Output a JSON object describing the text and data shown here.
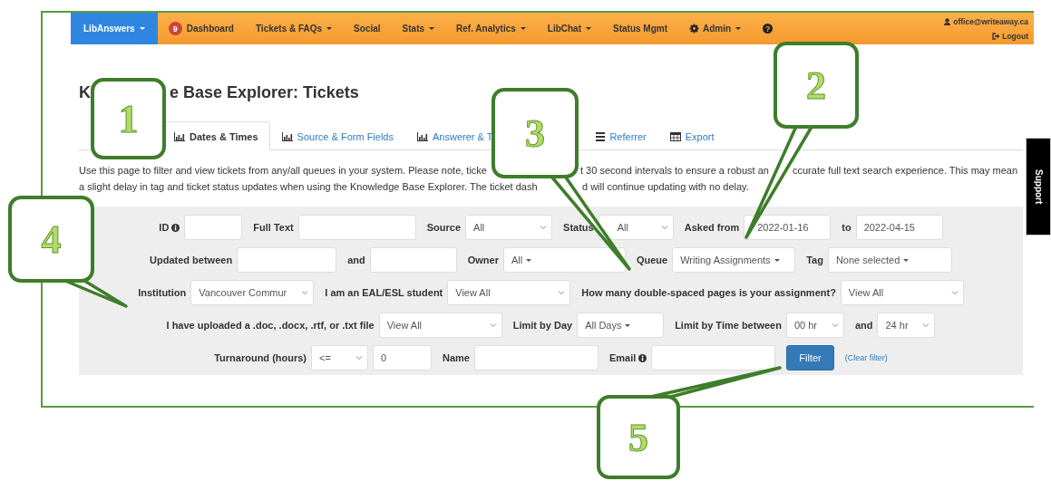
{
  "nav": {
    "items": [
      {
        "label": "LibAnswers",
        "dropdown": true,
        "selected": true
      },
      {
        "label": "Dashboard",
        "badge": "9",
        "dropdown": false,
        "selected": false
      },
      {
        "label": "Tickets & FAQs",
        "dropdown": true,
        "selected": false
      },
      {
        "label": "Social",
        "dropdown": false,
        "selected": false
      },
      {
        "label": "Stats",
        "dropdown": true,
        "selected": false
      },
      {
        "label": "Ref. Analytics",
        "dropdown": true,
        "selected": false
      },
      {
        "label": "LibChat",
        "dropdown": true,
        "selected": false
      },
      {
        "label": "Status Mgmt",
        "dropdown": false,
        "selected": false
      },
      {
        "label": "Admin",
        "dropdown": true,
        "selected": false
      }
    ],
    "help": "?",
    "user": "office@writeaway.ca",
    "logout": "Logout"
  },
  "title_fragments": [
    "K",
    "e Base Explorer: Tickets"
  ],
  "tabs": [
    {
      "label": "Dates & Times",
      "selected": true
    },
    {
      "label": "Source & Form Fields",
      "selected": false
    },
    {
      "label": "Answerer & T",
      "selected": false
    },
    {
      "label": "Referrer",
      "selected": false
    },
    {
      "label": "Export",
      "selected": false
    }
  ],
  "notice_lines": [
    [
      "Use this page to filter and view tickets from any/all queues in your system. Please note, ticke",
      "t 30 second intervals to ensure a robust an",
      "ccurate full text search experience. This may mean"
    ],
    [
      "a slight delay in tag and ticket status updates when using the Knowledge Base Explorer. The ticket dash",
      "d will continue updating with no delay."
    ]
  ],
  "filter_rows": [
    [
      {
        "label": "ID",
        "info": true,
        "controls": [
          {
            "kind": "input"
          }
        ]
      },
      {
        "label": "Full Text",
        "controls": [
          {
            "kind": "input"
          }
        ]
      },
      {
        "label": "Source",
        "controls": [
          {
            "kind": "select",
            "value": "All"
          }
        ]
      },
      {
        "label": "Status",
        "controls": [
          {
            "kind": "select",
            "value": "All"
          }
        ]
      },
      {
        "label": "Asked from",
        "controls": [
          {
            "kind": "input",
            "value": "2022-01-16"
          }
        ]
      },
      {
        "label": "to",
        "controls": [
          {
            "kind": "input",
            "value": "2022-04-15"
          }
        ]
      }
    ],
    [
      {
        "label": "Updated between",
        "controls": [
          {
            "kind": "input"
          }
        ]
      },
      {
        "label": "and",
        "controls": [
          {
            "kind": "input"
          }
        ]
      },
      {
        "label": "Owner",
        "controls": [
          {
            "kind": "dropdown",
            "value": "All"
          }
        ]
      },
      {
        "label": "Queue",
        "controls": [
          {
            "kind": "dropdown",
            "value": "Writing Assignments"
          }
        ]
      },
      {
        "label": "Tag",
        "controls": [
          {
            "kind": "dropdown",
            "value": "None selected"
          }
        ]
      }
    ],
    [
      {
        "label": "Institution",
        "controls": [
          {
            "kind": "select",
            "value": "Vancouver Commur"
          }
        ]
      },
      {
        "label": "I am an EAL/ESL student",
        "controls": [
          {
            "kind": "select",
            "value": "View All"
          }
        ]
      },
      {
        "label": "How many double-spaced pages is your assignment?",
        "controls": [
          {
            "kind": "select",
            "value": "View All"
          }
        ]
      }
    ],
    [
      {
        "label": "I have uploaded a .doc, .docx, .rtf, or .txt file",
        "controls": [
          {
            "kind": "select",
            "value": "View All"
          }
        ]
      },
      {
        "label": "Limit by Day",
        "controls": [
          {
            "kind": "dropdown",
            "value": "All Days"
          }
        ]
      },
      {
        "label": "Limit by Time between",
        "controls": [
          {
            "kind": "select",
            "value": "00 hr"
          }
        ]
      },
      {
        "label": "and",
        "controls": [
          {
            "kind": "select",
            "value": "24 hr"
          }
        ]
      }
    ],
    [
      {
        "label": "Turnaround (hours)",
        "controls": [
          {
            "kind": "select",
            "value": "<="
          },
          {
            "kind": "input",
            "value": "0"
          }
        ]
      },
      {
        "label": "Name",
        "controls": [
          {
            "kind": "input"
          }
        ]
      },
      {
        "label": "Email",
        "info": true,
        "controls": [
          {
            "kind": "input"
          }
        ]
      },
      {
        "controls": [
          {
            "kind": "button",
            "value": "Filter"
          },
          {
            "kind": "link",
            "value": "(Clear filter)"
          }
        ]
      }
    ]
  ],
  "support_tab": "Support",
  "callouts": [
    {
      "number": "1"
    },
    {
      "number": "2"
    },
    {
      "number": "3"
    },
    {
      "number": "4"
    },
    {
      "number": "5"
    }
  ]
}
